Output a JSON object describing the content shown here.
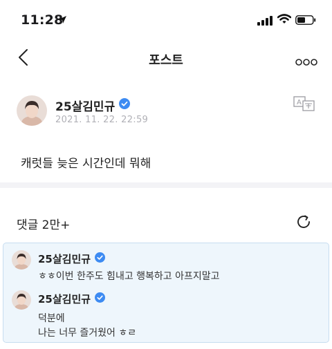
{
  "status_bar": {
    "time": "11:28"
  },
  "nav": {
    "title": "포스트"
  },
  "post": {
    "author": "25살김민규",
    "date": "2021. 11. 22. 22:59",
    "text": "캐럿들 늦은 시간인데 뭐해"
  },
  "comments": {
    "count_label": "댓글 2만+",
    "items": [
      {
        "author": "25살김민규",
        "lines": [
          "ㅎㅎ이번 한주도 힘내고 행복하고 아프지말고"
        ]
      },
      {
        "author": "25살김민규",
        "lines": [
          "덕분에",
          "나는 너무 즐거웠어 ㅎㄹ"
        ]
      }
    ]
  },
  "colors": {
    "verified": "#3d8bf2",
    "highlight_bg": "#eef6fc",
    "highlight_border": "#c6ddf0"
  }
}
